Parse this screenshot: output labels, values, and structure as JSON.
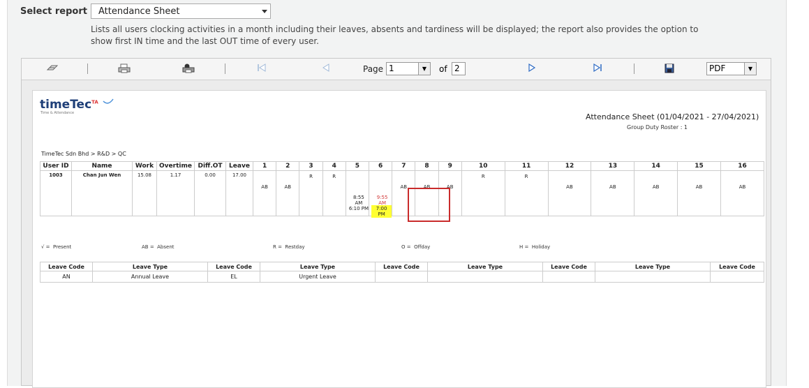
{
  "select_report": {
    "label": "Select report",
    "value": "Attendance Sheet",
    "description": "Lists all users clocking activities in a month including their leaves, absents and tardiness will be displayed; the report also provides the option to show first IN time and the last OUT time of every user."
  },
  "toolbar": {
    "page_label": "Page",
    "page_value": "1",
    "of_label": "of",
    "total_pages": "2",
    "format_value": "PDF"
  },
  "report": {
    "logo_text": "timeTec",
    "logo_badge": "TA",
    "logo_sub": "Time & Attendance",
    "title": "Attendance Sheet (01/04/2021 - 27/04/2021)",
    "subtitle": "Group Duty Roster : 1",
    "breadcrumb": "TimeTec Sdn Bhd > R&D > QC",
    "columns": [
      "User ID",
      "Name",
      "Work",
      "Overtime",
      "Diff.OT",
      "Leave",
      "1",
      "2",
      "3",
      "4",
      "5",
      "6",
      "7",
      "8",
      "9",
      "10",
      "11",
      "12",
      "13",
      "14",
      "15",
      "16"
    ],
    "row": {
      "user_id": "1003",
      "name": "Chan Jun Wen",
      "work": "15.08",
      "overtime": "1.17",
      "diff_ot": "0.00",
      "leave": "17.00",
      "days": {
        "d1": "AB",
        "d2": "AB",
        "d3": "R",
        "d4": "R",
        "d5_in": "8:55 AM",
        "d5_out": "6:10 PM",
        "d6_in": "9:55 AM",
        "d6_out": "7:00 PM",
        "d7": "AB",
        "d8": "AB",
        "d9": "AB",
        "d10": "R",
        "d11": "R",
        "d12": "AB",
        "d13": "AB",
        "d14": "AB",
        "d15": "AB",
        "d16": "AB"
      }
    },
    "legend": [
      {
        "code": "√ =",
        "label": "Present"
      },
      {
        "code": "AB =",
        "label": "Absent"
      },
      {
        "code": "R =",
        "label": "Restday"
      },
      {
        "code": "O =",
        "label": "Offday"
      },
      {
        "code": "H =",
        "label": "Holiday"
      }
    ],
    "leave_headers": [
      "Leave Code",
      "Leave Type",
      "Leave Code",
      "Leave Type",
      "Leave Code",
      "Leave Type",
      "Leave Code",
      "Leave Type",
      "Leave Code"
    ],
    "leave_row": [
      "AN",
      "Annual Leave",
      "EL",
      "Urgent Leave",
      "",
      "",
      "",
      "",
      ""
    ]
  },
  "colors": {
    "highlight_border": "#c92b2b",
    "late_text": "#d23a3a",
    "late_out_bg": "#ffff33",
    "logo": "#1f3f78"
  }
}
